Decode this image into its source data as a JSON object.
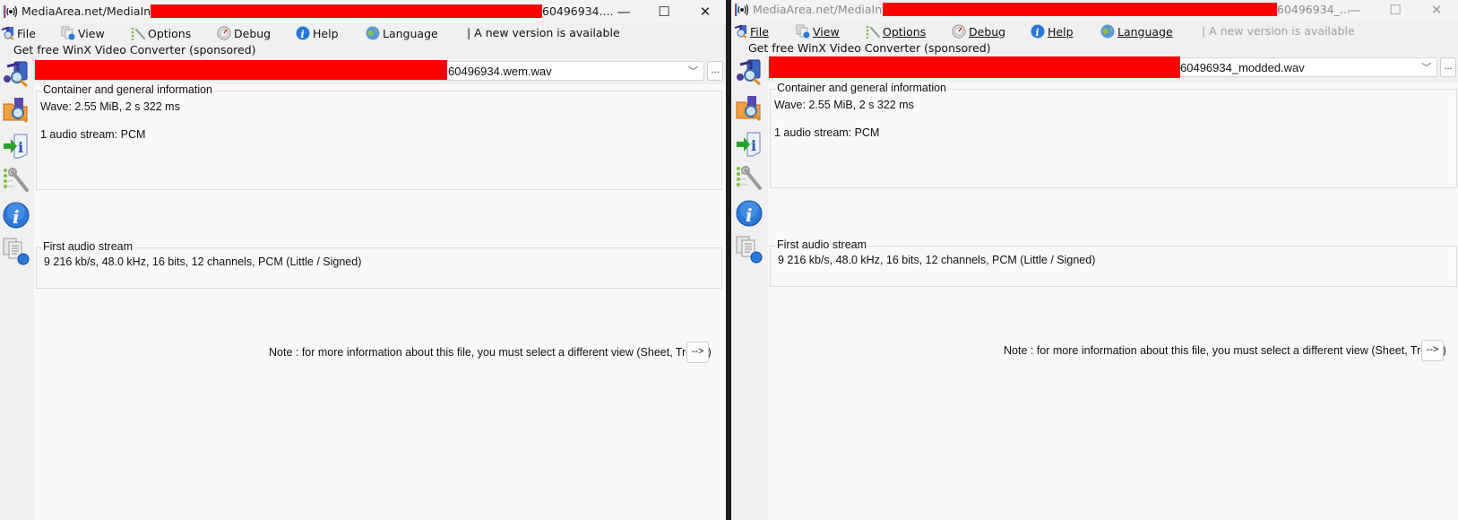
{
  "windows": [
    {
      "id": "left",
      "title_prefix": "MediaArea.net/MediaInfo -",
      "title_suffix": "60496934....",
      "window_controls": {
        "minimize": "—",
        "maximize": "☐",
        "close": "✕"
      },
      "menu": [
        {
          "label": "File",
          "icon": "file-open-icon"
        },
        {
          "label": "View",
          "icon": "view-icon"
        },
        {
          "label": "Options",
          "icon": "options-icon"
        },
        {
          "label": "Debug",
          "icon": "debug-icon"
        },
        {
          "label": "Help",
          "icon": "help-icon"
        },
        {
          "label": "Language",
          "icon": "language-globe-icon"
        }
      ],
      "new_version_note": "| A new version is available",
      "sponsored_link": "Get free WinX Video Converter (sponsored)",
      "file_combo": {
        "value_suffix": "60496934.wem.wav",
        "browse_label": "..."
      },
      "sidebar_icons": [
        "open-file-icon",
        "open-folder-icon",
        "export-icon",
        "preferences-icon",
        "about-icon",
        "sheet-view-icon"
      ],
      "groups": [
        {
          "title": "Container and general information",
          "lines": [
            "Wave: 2.55 MiB, 2 s 322 ms",
            "",
            "1 audio stream: PCM"
          ]
        },
        {
          "title": "First audio stream",
          "lines": [
            "9 216 kb/s, 48.0 kHz, 16 bits, 12 channels, PCM (Little / Signed)"
          ]
        }
      ],
      "note": "Note : for more information about this file, you must select a different view (Sheet, Tree...)",
      "more_button": "-->"
    },
    {
      "id": "right",
      "title_prefix": "MediaArea.net/MediaInfo -",
      "title_suffix": "60496934_...",
      "window_controls": {
        "minimize": "—",
        "maximize": "☐",
        "close": "✕"
      },
      "menu": [
        {
          "label": "File",
          "icon": "file-open-icon"
        },
        {
          "label": "View",
          "icon": "view-icon"
        },
        {
          "label": "Options",
          "icon": "options-icon"
        },
        {
          "label": "Debug",
          "icon": "debug-icon"
        },
        {
          "label": "Help",
          "icon": "help-icon"
        },
        {
          "label": "Language",
          "icon": "language-globe-icon"
        }
      ],
      "new_version_note": "| A new version is available",
      "sponsored_link": "Get free WinX Video Converter (sponsored)",
      "file_combo": {
        "value_suffix": "60496934_modded.wav",
        "browse_label": "..."
      },
      "sidebar_icons": [
        "open-file-icon",
        "open-folder-icon",
        "export-icon",
        "preferences-icon",
        "about-icon",
        "sheet-view-icon"
      ],
      "groups": [
        {
          "title": "Container and general information",
          "lines": [
            "Wave: 2.55 MiB, 2 s 322 ms",
            "",
            "1 audio stream: PCM"
          ]
        },
        {
          "title": "First audio stream",
          "lines": [
            "9 216 kb/s, 48.0 kHz, 16 bits, 12 channels, PCM (Little / Signed)"
          ]
        }
      ],
      "note": "Note : for more information about this file, you must select a different view (Sheet, Tree...)",
      "more_button": "-->"
    }
  ],
  "colors": {
    "redaction": "#ff0000",
    "window_bg": "#f0f0f0",
    "content_bg": "#f9f9f9"
  }
}
